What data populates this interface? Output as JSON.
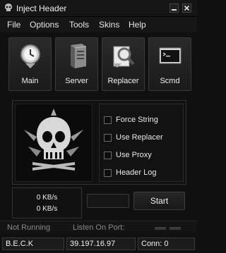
{
  "window": {
    "title": "Inject Header"
  },
  "menu": [
    "File",
    "Options",
    "Tools",
    "Skins",
    "Help"
  ],
  "toolbar": [
    {
      "label": "Main",
      "icon": "clock-arrow-icon"
    },
    {
      "label": "Server",
      "icon": "server-icon"
    },
    {
      "label": "Replacer",
      "icon": "replacer-magnifier-icon"
    },
    {
      "label": "Scmd",
      "icon": "console-icon"
    }
  ],
  "options": [
    {
      "label": "Force String",
      "checked": false
    },
    {
      "label": "Use Replacer",
      "checked": false
    },
    {
      "label": "Use Proxy",
      "checked": false
    },
    {
      "label": "Header Log",
      "checked": false
    }
  ],
  "stats": {
    "upload": "0 KB/s",
    "download": "0 KB/s"
  },
  "actions": {
    "start": "Start"
  },
  "status": {
    "state": "Not Running",
    "listen_label": "Listen On Port:"
  },
  "info": {
    "name": "B.E.C.K",
    "ip": "39.197.16.97",
    "connections": "Conn: 0"
  }
}
